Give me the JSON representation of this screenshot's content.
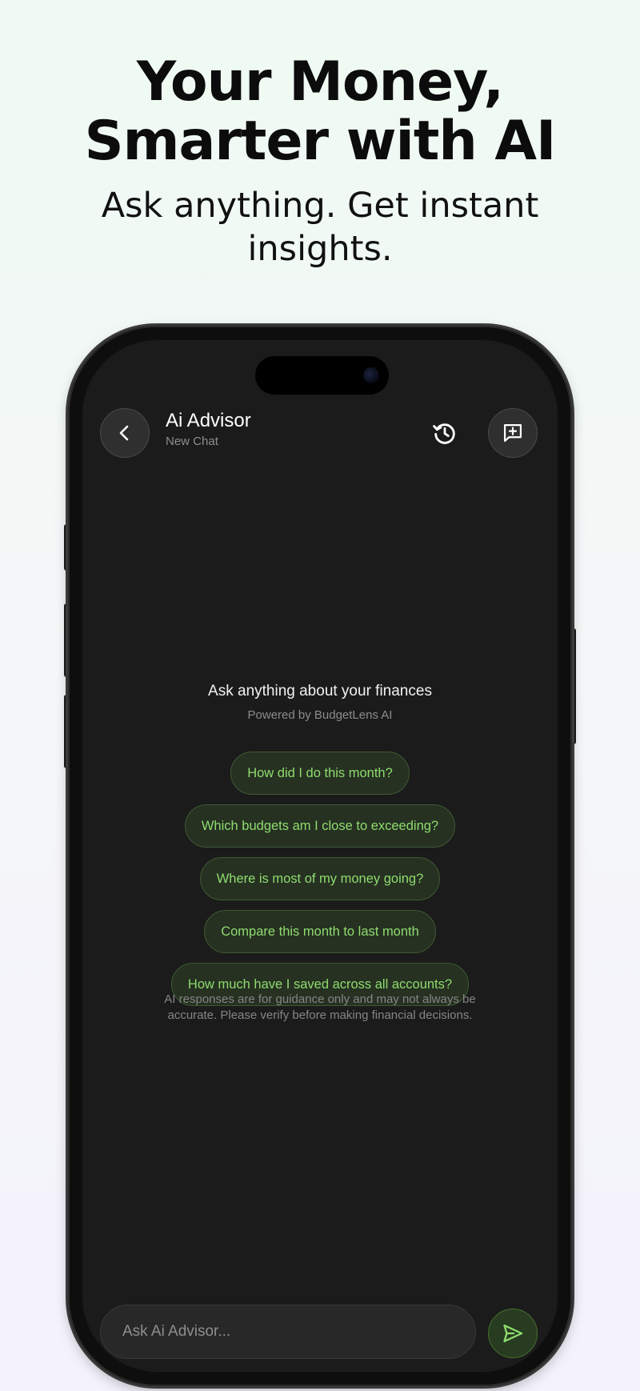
{
  "hero": {
    "title_line1": "Your Money,",
    "title_line2": "Smarter with AI",
    "subtitle_line1": "Ask anything. Get instant",
    "subtitle_line2": "insights."
  },
  "header": {
    "title": "Ai Advisor",
    "subtitle": "New Chat",
    "back_icon": "chevron-left-icon",
    "history_icon": "history-icon",
    "new_chat_icon": "add-chat-icon"
  },
  "empty_state": {
    "title": "Ask anything about your finances",
    "subtitle": "Powered by BudgetLens AI"
  },
  "suggestions": [
    "How did I do this month?",
    "Which budgets am I close to exceeding?",
    "Where is most of my money going?",
    "Compare this month to last month",
    "How much have I saved across all accounts?"
  ],
  "disclaimer": "AI responses are for guidance only and may not always be accurate. Please verify before making financial decisions.",
  "composer": {
    "placeholder": "Ask Ai Advisor...",
    "send_icon": "send-icon"
  },
  "colors": {
    "accent": "#8fdc6e",
    "screen_bg": "#1b1b1b"
  }
}
